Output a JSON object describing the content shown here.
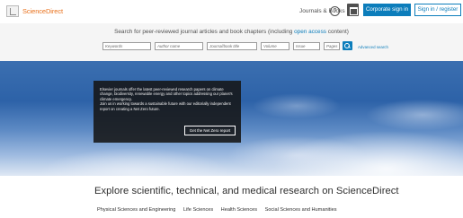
{
  "header": {
    "logo_text": "ScienceDirect",
    "journals_books": "Journals & Books",
    "help_symbol": "?",
    "corporate_signin": "Corporate sign in",
    "signin_register": "Sign in / register"
  },
  "search": {
    "heading_prefix": "Search for peer-reviewed journal articles and book chapters (including ",
    "heading_link": "open access",
    "heading_suffix": " content)",
    "fields": {
      "keywords": "Keywords",
      "author": "Author name",
      "journal": "Journal/book title",
      "volume": "Volume",
      "issue": "Issue",
      "pages": "Pages"
    },
    "advanced": "Advanced search"
  },
  "promo": {
    "line1": "Elsevier journals offer the latest peer-reviewed research papers on climate change, biodiversity, renewable energy and other topics addressing our planet's climate emergency.",
    "line2": "Join us in working towards a sustainable future with our editorially independent report on creating a Net Zero future.",
    "button": "Get the Net Zero report"
  },
  "explore": {
    "title": "Explore scientific, technical, and medical research on ScienceDirect",
    "subjects": [
      "Physical Sciences and Engineering",
      "Life Sciences",
      "Health Sciences",
      "Social Sciences and Humanities"
    ]
  },
  "colors": {
    "brand_orange": "#e9711c",
    "accent_blue": "#0c7dbb",
    "promo_bg": "#161616"
  }
}
